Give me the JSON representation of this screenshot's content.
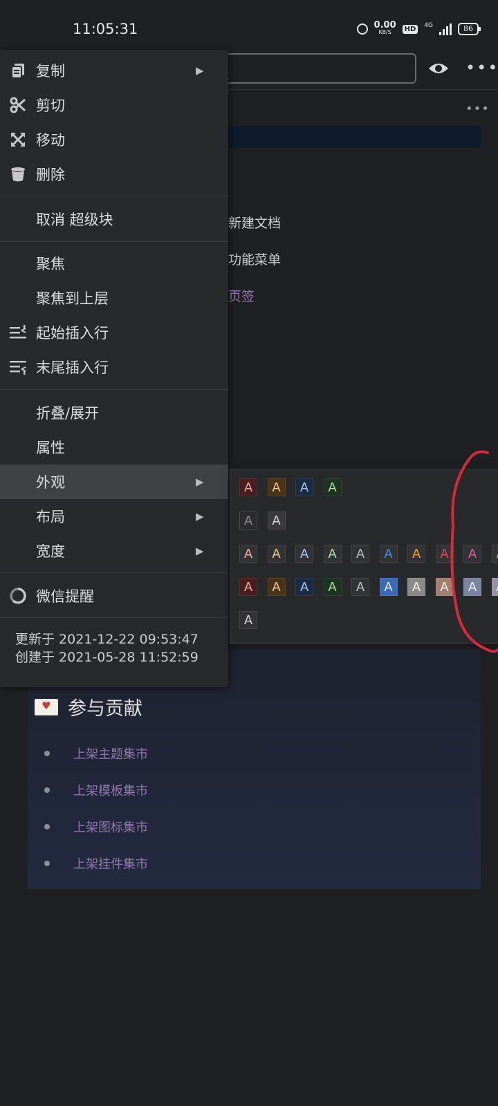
{
  "status_bar": {
    "time": "11:05:31",
    "net_speed": "0.00",
    "net_speed_unit": "KB/S",
    "hd_label": "HD",
    "network_type": "4G",
    "battery": "86"
  },
  "background": {
    "items": [
      "新建文档",
      "功能菜单",
      "页签"
    ],
    "card": {
      "title": "参与贡献",
      "items": [
        "上架主题集市",
        "上架模板集市",
        "上架图标集市",
        "上架挂件集市"
      ]
    }
  },
  "menu": {
    "copy": "复制",
    "cut": "剪切",
    "move": "移动",
    "delete": "删除",
    "cancel_superblock": "取消 超级块",
    "focus": "聚焦",
    "focus_parent": "聚焦到上层",
    "insert_before": "起始插入行",
    "insert_after": "末尾插入行",
    "fold": "折叠/展开",
    "attributes": "属性",
    "appearance": "外观",
    "layout": "布局",
    "width": "宽度",
    "wechat_reminder": "微信提醒",
    "updated": "更新于 2021-12-22 09:53:47",
    "created": "创建于 2021-05-28 11:52:59"
  },
  "appearance": {
    "glyph": "A",
    "row1": [
      {
        "bg": "#4a1e1e",
        "fg": "#f0a8a8"
      },
      {
        "bg": "#4a3418",
        "fg": "#f0c890"
      },
      {
        "bg": "#1a2c44",
        "fg": "#a8c4f0"
      },
      {
        "bg": "#1c3420",
        "fg": "#a8e0b0"
      }
    ],
    "row2": [
      {
        "bg": "#2c2c2e",
        "fg": "#8a8a8a",
        "border": "#4a4a4c"
      },
      {
        "bg": "#3a3a3c",
        "fg": "#d8d8d8"
      }
    ],
    "row3": [
      {
        "bg": "#333336",
        "fg": "#f0a8a8"
      },
      {
        "bg": "#333336",
        "fg": "#f0c890"
      },
      {
        "bg": "#333336",
        "fg": "#a8c4f0"
      },
      {
        "bg": "#333336",
        "fg": "#a8e0b0"
      },
      {
        "bg": "#333336",
        "fg": "#b8b8b8"
      },
      {
        "bg": "#333336",
        "fg": "#4a8ae0"
      },
      {
        "bg": "#333336",
        "fg": "#e8a040"
      },
      {
        "bg": "#333336",
        "fg": "#d85050"
      },
      {
        "bg": "#333336",
        "fg": "#d860a0"
      },
      {
        "bg": "#333336",
        "fg": "#909090"
      }
    ],
    "row4": [
      {
        "bg": "#4a1e1e",
        "fg": "#f0a8a8"
      },
      {
        "bg": "#4a3418",
        "fg": "#f0c890"
      },
      {
        "bg": "#1a2c44",
        "fg": "#a8c4f0"
      },
      {
        "bg": "#1c3420",
        "fg": "#a8e0b0"
      },
      {
        "bg": "#333336",
        "fg": "#c0c0c0"
      },
      {
        "bg": "#3a6ab8",
        "fg": "#e8f0ff"
      },
      {
        "bg": "#8a8a8a",
        "fg": "#f0f0f0"
      },
      {
        "bg": "#a08070",
        "fg": "#f4ece4"
      },
      {
        "bg": "#7a84a0",
        "fg": "#eef0f8"
      },
      {
        "bg": "#9a90a8",
        "fg": "#f0ecf4"
      }
    ],
    "row5": [
      {
        "bg": "#333336",
        "fg": "#d8d8d8"
      }
    ]
  }
}
